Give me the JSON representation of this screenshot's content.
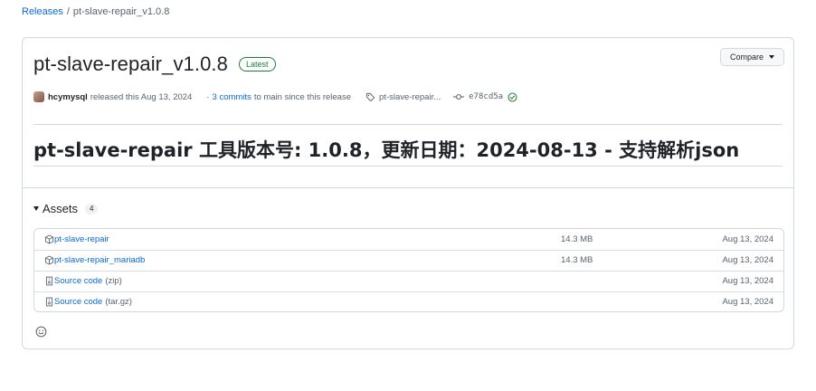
{
  "breadcrumb": {
    "releases": "Releases",
    "separator": "/",
    "current": "pt-slave-repair_v1.0.8"
  },
  "release": {
    "title": "pt-slave-repair_v1.0.8",
    "badge": "Latest",
    "compare_label": "Compare",
    "author": "hcymysql",
    "released_text": "released this Aug 13, 2024",
    "dot": "·",
    "commits_link": "3 commits",
    "commits_suffix": "to main since this release",
    "tag": "pt-slave-repair...",
    "commit_hash": "e78cd5a",
    "body_heading": "pt-slave-repair 工具版本号: 1.0.8，更新日期：2024-08-13 - 支持解析json"
  },
  "assets": {
    "label": "Assets",
    "count": "4",
    "items": [
      {
        "name": "pt-slave-repair",
        "suffix": "",
        "size": "14.3 MB",
        "date": "Aug 13, 2024",
        "icon": "package-icon"
      },
      {
        "name": "pt-slave-repair_mariadb",
        "suffix": "",
        "size": "14.3 MB",
        "date": "Aug 13, 2024",
        "icon": "package-icon"
      },
      {
        "name": "Source code",
        "suffix": "(zip)",
        "size": "",
        "date": "Aug 13, 2024",
        "icon": "file-zip-icon"
      },
      {
        "name": "Source code",
        "suffix": "(tar.gz)",
        "size": "",
        "date": "Aug 13, 2024",
        "icon": "file-zip-icon"
      }
    ]
  },
  "colors": {
    "link": "#0969da",
    "success": "#1a7f37",
    "border": "#d1d9e0",
    "muted": "#59636e"
  }
}
